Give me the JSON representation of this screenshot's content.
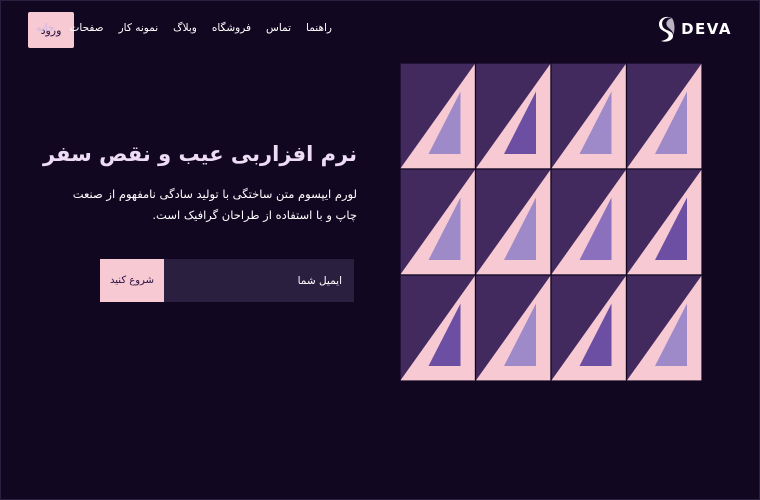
{
  "header": {
    "login_label": "ورود",
    "nav": [
      {
        "label": "خانه",
        "active": true
      },
      {
        "label": "صفحات",
        "active": false
      },
      {
        "label": "نمونه کار",
        "active": false
      },
      {
        "label": "وبلاگ",
        "active": false
      },
      {
        "label": "فروشگاه",
        "active": false
      },
      {
        "label": "تماس",
        "active": false
      },
      {
        "label": "راهنما",
        "active": false
      }
    ],
    "brand": "DEVA"
  },
  "hero": {
    "title": "نرم افزاربی عیب و نقص سفر",
    "subtitle": "لورم ایپسوم متن ساختگی با تولید سادگی نامفهوم از صنعت چاپ و با استفاده از طراحان گرافیک است.",
    "email_placeholder": "ایمیل شما",
    "cta_label": "شروع کنید"
  },
  "colors": {
    "background": "#120721",
    "accent_pink": "#f6c9d3",
    "tile_dark": "#432a5e",
    "lavender": [
      "#9e8ac8",
      "#6c4ea2",
      "#8a70bd"
    ]
  }
}
